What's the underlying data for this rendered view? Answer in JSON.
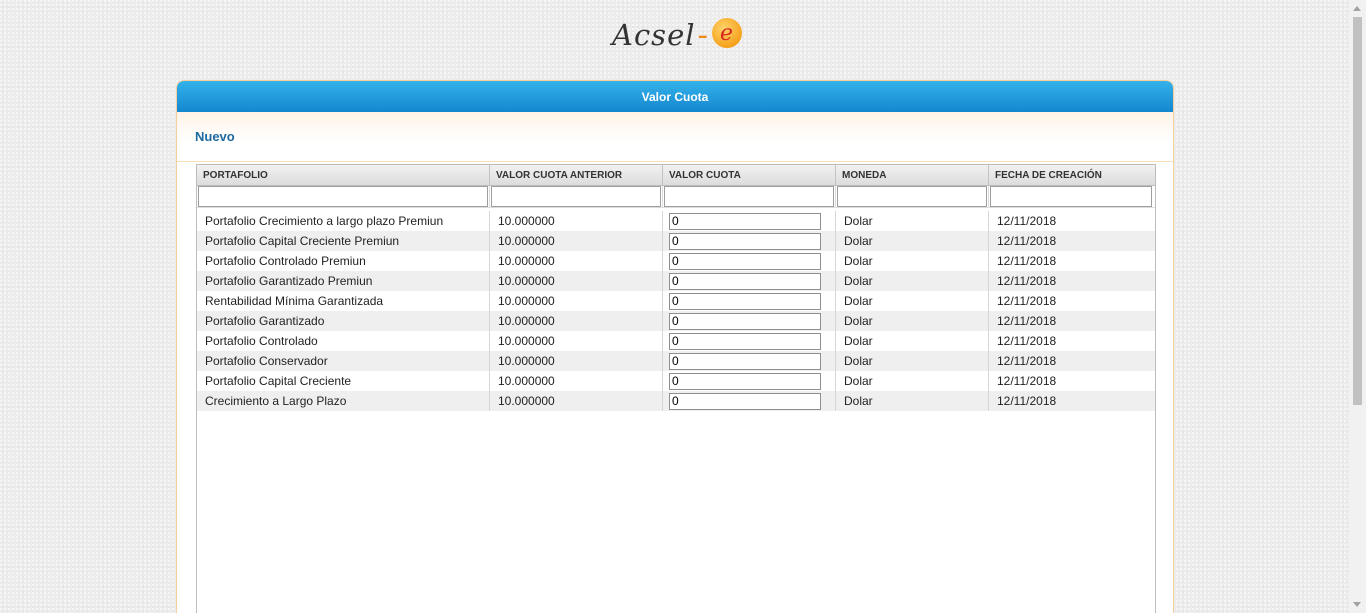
{
  "logo": {
    "text": "Acsel",
    "dash": "-",
    "badge": "e"
  },
  "panel": {
    "title": "Valor Cuota",
    "section": "Nuevo"
  },
  "grid": {
    "headers": [
      "PORTAFOLIO",
      "VALOR CUOTA ANTERIOR",
      "VALOR CUOTA",
      "MONEDA",
      "FECHA DE CREACIÓN"
    ],
    "rows": [
      {
        "portafolio": "Portafolio Crecimiento a largo plazo Premiun",
        "anterior": "10.000000",
        "valor": "0",
        "moneda": "Dolar",
        "fecha": "12/11/2018"
      },
      {
        "portafolio": "Portafolio Capital Creciente Premiun",
        "anterior": "10.000000",
        "valor": "0",
        "moneda": "Dolar",
        "fecha": "12/11/2018"
      },
      {
        "portafolio": "Portafolio Controlado Premiun",
        "anterior": "10.000000",
        "valor": "0",
        "moneda": "Dolar",
        "fecha": "12/11/2018"
      },
      {
        "portafolio": "Portafolio Garantizado Premiun",
        "anterior": "10.000000",
        "valor": "0",
        "moneda": "Dolar",
        "fecha": "12/11/2018"
      },
      {
        "portafolio": "Rentabilidad Mínima Garantizada",
        "anterior": "10.000000",
        "valor": "0",
        "moneda": "Dolar",
        "fecha": "12/11/2018"
      },
      {
        "portafolio": "Portafolio Garantizado",
        "anterior": "10.000000",
        "valor": "0",
        "moneda": "Dolar",
        "fecha": "12/11/2018"
      },
      {
        "portafolio": "Portafolio Controlado",
        "anterior": "10.000000",
        "valor": "0",
        "moneda": "Dolar",
        "fecha": "12/11/2018"
      },
      {
        "portafolio": "Portafolio Conservador",
        "anterior": "10.000000",
        "valor": "0",
        "moneda": "Dolar",
        "fecha": "12/11/2018"
      },
      {
        "portafolio": "Portafolio Capital Creciente",
        "anterior": "10.000000",
        "valor": "0",
        "moneda": "Dolar",
        "fecha": "12/11/2018"
      },
      {
        "portafolio": "Crecimiento a Largo Plazo",
        "anterior": "10.000000",
        "valor": "0",
        "moneda": "Dolar",
        "fecha": "12/11/2018"
      }
    ]
  },
  "colors": {
    "header_blue": "#1e96dc",
    "accent_orange": "#f08a1c",
    "section_title": "#1e6aa0"
  }
}
